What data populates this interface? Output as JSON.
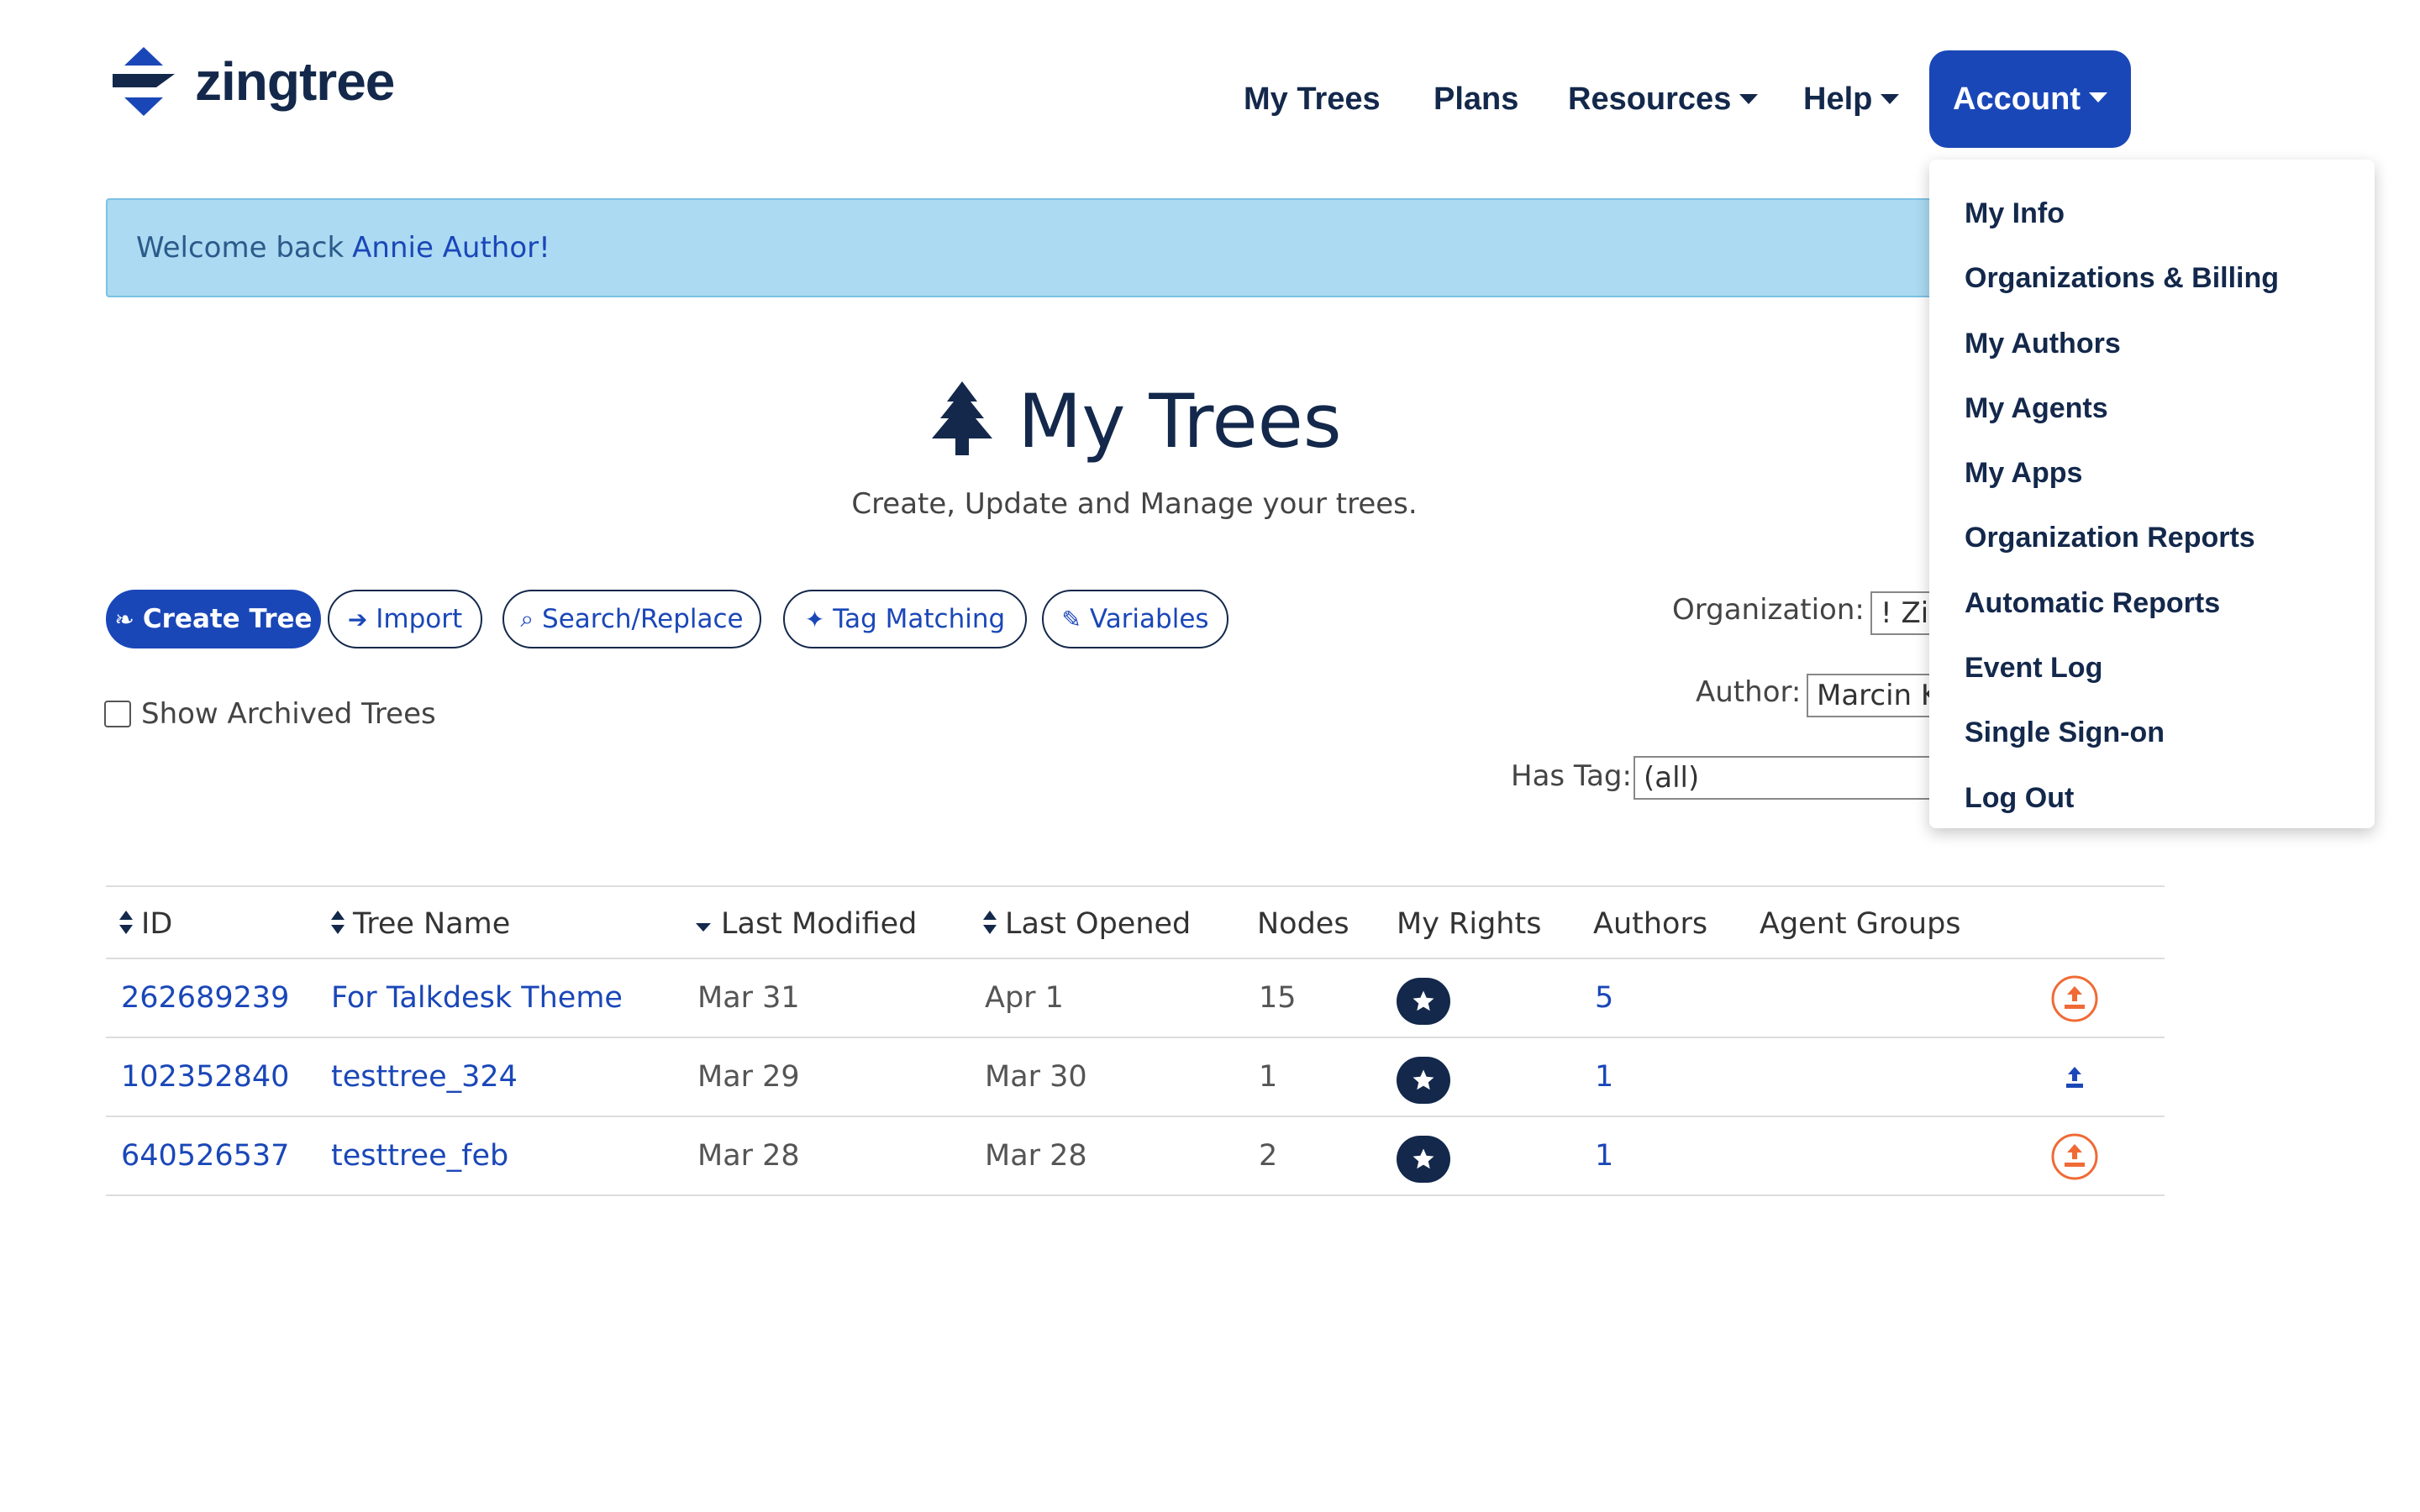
{
  "brand": {
    "name": "zingtree"
  },
  "nav": {
    "my_trees": "My Trees",
    "plans": "Plans",
    "resources": "Resources",
    "help": "Help",
    "account": "Account"
  },
  "account_menu": [
    "My Info",
    "Organizations & Billing",
    "My Authors",
    "My Agents",
    "My Apps",
    "Organization Reports",
    "Automatic Reports",
    "Event Log",
    "Single Sign-on",
    "Log Out"
  ],
  "welcome": {
    "prefix": "Welcome back",
    "user": "Annie Author!"
  },
  "page": {
    "title": "My Trees",
    "subtitle": "Create, Update and Manage your trees."
  },
  "toolbar": {
    "create_tree": "Create Tree",
    "import": "Import",
    "search_replace": "Search/Replace",
    "tag_matching": "Tag Matching",
    "variables": "Variables"
  },
  "show_archived": "Show Archived Trees",
  "filters": {
    "organization_label": "Organization:",
    "organization_value": "! Zin",
    "author_label": "Author:",
    "author_value": "Marcin K",
    "has_tag_label": "Has Tag:",
    "has_tag_value": "(all)"
  },
  "table": {
    "headers": {
      "id": "ID",
      "tree_name": "Tree Name",
      "last_modified": "Last Modified",
      "last_opened": "Last Opened",
      "nodes": "Nodes",
      "my_rights": "My Rights",
      "authors": "Authors",
      "agent_groups": "Agent Groups"
    },
    "rows": [
      {
        "id": "262689239",
        "name": "For Talkdesk Theme",
        "last_modified": "Mar 31",
        "last_opened": "Apr 1",
        "nodes": "15",
        "authors": "5",
        "export_icon": "export-circle-orange"
      },
      {
        "id": "102352840",
        "name": "testtree_324",
        "last_modified": "Mar 29",
        "last_opened": "Mar 30",
        "nodes": "1",
        "authors": "1",
        "export_icon": "export-plain-blue"
      },
      {
        "id": "640526537",
        "name": "testtree_feb",
        "last_modified": "Mar 28",
        "last_opened": "Mar 28",
        "nodes": "2",
        "authors": "1",
        "export_icon": "export-circle-orange"
      }
    ]
  },
  "colors": {
    "brand_navy": "#13284b",
    "accent_blue": "#1a47b8",
    "banner_bg": "#acdaf2",
    "export_orange": "#f06a35"
  }
}
